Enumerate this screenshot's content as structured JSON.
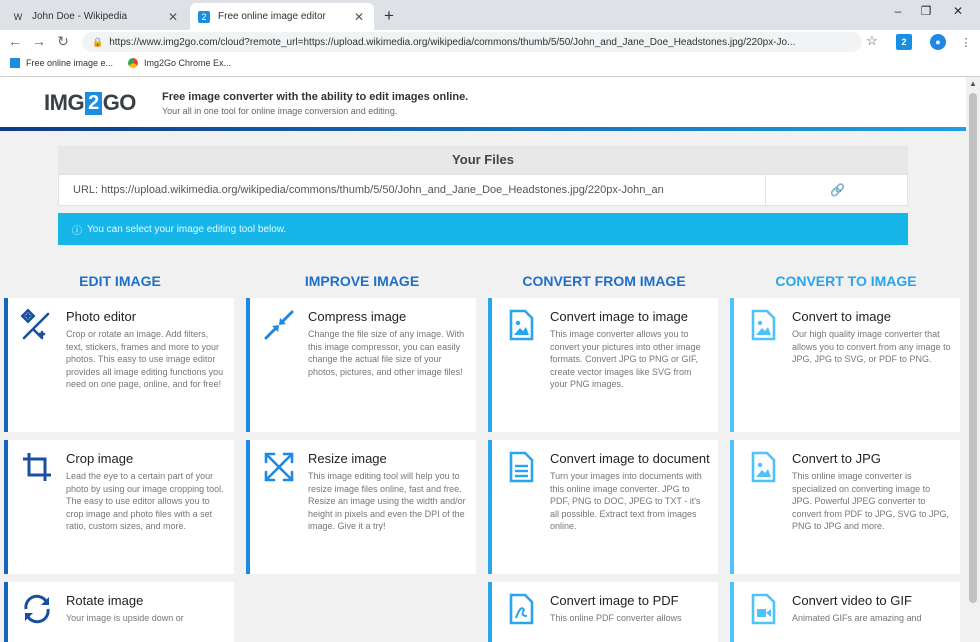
{
  "browser": {
    "tabs": [
      {
        "title": "John Doe - Wikipedia",
        "favicon": "W",
        "active": false
      },
      {
        "title": "Free online image editor",
        "favicon": "2",
        "active": true
      }
    ],
    "new_tab": "+",
    "window_controls": [
      "–",
      "❐",
      "✕"
    ],
    "url": "https://www.img2go.com/cloud?remote_url=https://upload.wikimedia.org/wikipedia/commons/thumb/5/50/John_and_Jane_Doe_Headstones.jpg/220px-Jo...",
    "bookmarks": [
      "Free online image e...",
      "Img2Go Chrome Ex..."
    ]
  },
  "site": {
    "logo": {
      "part1": "IMG",
      "part2": "2",
      "part3": "GO"
    },
    "tagline": "Free image converter with the ability to edit images online.",
    "subtagline": "Your all in one tool for online image conversion and editing."
  },
  "files": {
    "heading": "Your Files",
    "url_line": "URL: https://upload.wikimedia.org/wikipedia/commons/thumb/5/50/John_and_Jane_Doe_Headstones.jpg/220px-John_an"
  },
  "info": "You can select your image editing tool below.",
  "columns": [
    {
      "heading": "EDIT IMAGE",
      "cards": [
        {
          "title": "Photo editor",
          "icon": "magic-wand-icon",
          "desc": "Crop or rotate an image. Add filters, text, stickers, frames and more to your photos. This easy to use image editor provides all image editing functions you need on one page, online, and for free!"
        },
        {
          "title": "Crop image",
          "icon": "crop-icon",
          "desc": "Lead the eye to a certain part of your photo by using our image cropping tool. The easy to use editor allows you to crop image and photo files with a set ratio, custom sizes, and more."
        },
        {
          "title": "Rotate image",
          "icon": "rotate-icon",
          "desc": "Your image is upside down or"
        }
      ]
    },
    {
      "heading": "IMPROVE IMAGE",
      "cards": [
        {
          "title": "Compress image",
          "icon": "compress-icon",
          "desc": "Change the file size of any image. With this image compressor, you can easily change the actual file size of your photos, pictures, and other image files!"
        },
        {
          "title": "Resize image",
          "icon": "resize-icon",
          "desc": "This image editing tool will help you to resize image files online, fast and free. Resize an image using the width and/or height in pixels and even the DPI of the image. Give it a try!"
        }
      ]
    },
    {
      "heading": "CONVERT FROM IMAGE",
      "cards": [
        {
          "title": "Convert image to image",
          "icon": "image-file-icon",
          "desc": "This image converter allows you to convert your pictures into other image formats. Convert JPG to PNG or GIF, create vector images like SVG from your PNG images."
        },
        {
          "title": "Convert image to document",
          "icon": "document-icon",
          "desc": "Turn your images into documents with this online image converter. JPG to PDF, PNG to DOC, JPEG to TXT - it's all possible. Extract text from images online."
        },
        {
          "title": "Convert image to PDF",
          "icon": "pdf-icon",
          "desc": "This online PDF converter allows"
        }
      ]
    },
    {
      "heading": "CONVERT TO IMAGE",
      "cards": [
        {
          "title": "Convert to image",
          "icon": "image-file-icon",
          "desc": "Our high quality image converter that allows you to convert from any image to JPG, JPG to SVG, or PDF to PNG."
        },
        {
          "title": "Convert to JPG",
          "icon": "image-file-icon",
          "desc": "This online image converter is specialized on converting image to JPG. Powerful JPEG converter to convert from PDF to JPG, SVG to JPG, PNG to JPG and more."
        },
        {
          "title": "Convert video to GIF",
          "icon": "video-file-icon",
          "desc": "Animated GIFs are amazing and"
        }
      ]
    }
  ],
  "colors": {
    "accent": "#1d6fc9",
    "info_bg": "#16b6e8",
    "logo_blue": "#1a8ee0"
  }
}
